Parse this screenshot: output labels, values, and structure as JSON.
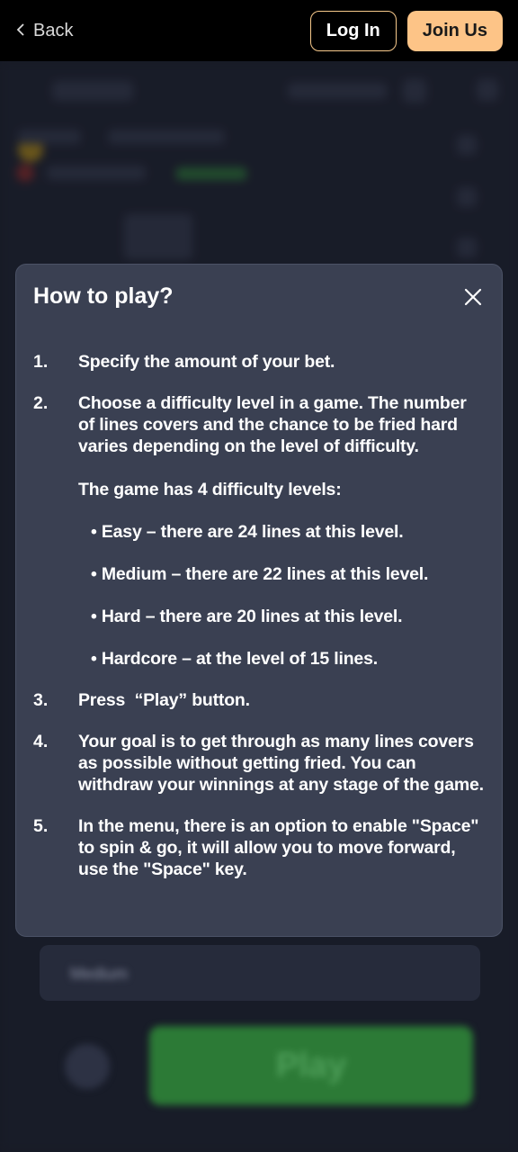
{
  "topbar": {
    "back_label": "Back",
    "login_label": "Log In",
    "join_label": "Join Us"
  },
  "background": {
    "play_label": "Play",
    "difficulty_value": "Medium"
  },
  "modal": {
    "title": "How to play?",
    "steps": [
      {
        "num": "1.",
        "text": "Specify the amount of your bet."
      },
      {
        "num": "2.",
        "text": "Choose a difficulty level in a game. The number of lines covers and the chance to be fried hard varies depending on the level of difficulty.",
        "sub": "The game has 4 difficulty levels:",
        "bullets": [
          "• Easy – there are 24 lines at this level.",
          "• Medium – there are 22 lines at this level.",
          "• Hard – there are 20 lines at this level.",
          "• Hardcore – at the level of 15 lines."
        ]
      },
      {
        "num": "3.",
        "text": "Press  “Play” button."
      },
      {
        "num": "4.",
        "text": "Your goal is to get through as many lines covers as possible without getting fried. You can withdraw your winnings at any stage of the game."
      },
      {
        "num": "5.",
        "text": "In the menu, there is an option to enable \"Space\" to spin & go, it will allow you to move forward, use the \"Space\" key."
      }
    ]
  },
  "colors": {
    "accent": "#fdc487",
    "modal_bg": "#3a4052",
    "topbar_bg": "#000000"
  }
}
